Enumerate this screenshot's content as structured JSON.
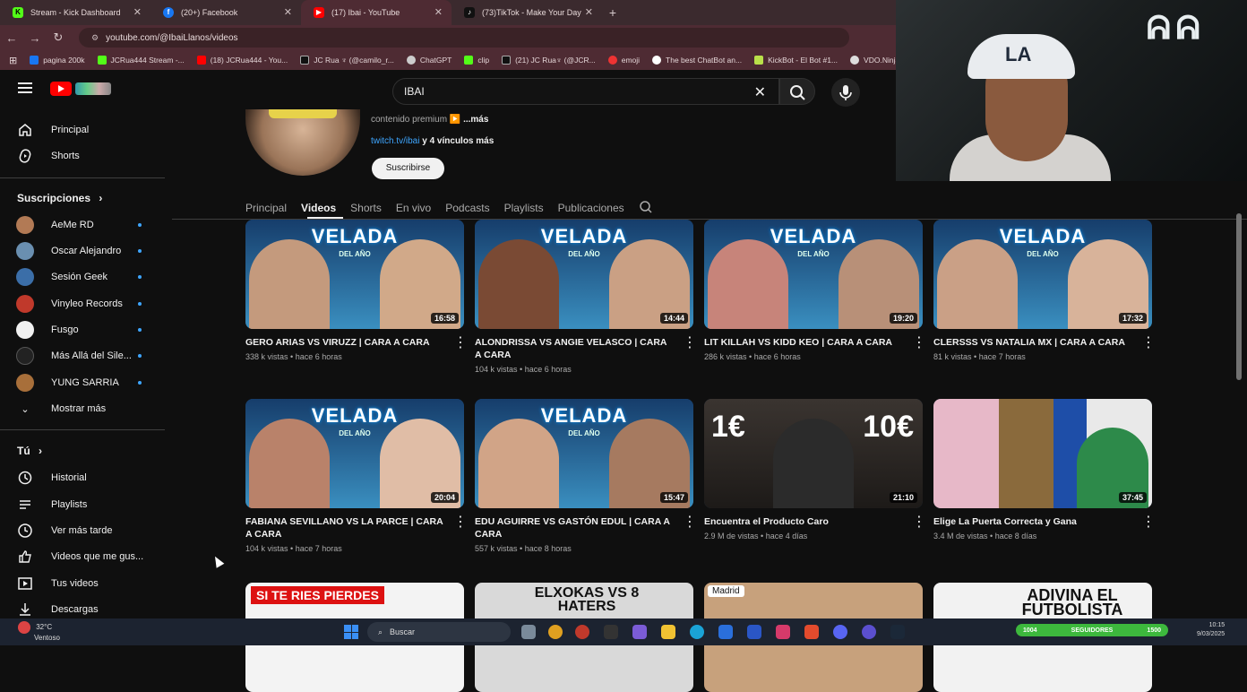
{
  "browser": {
    "tabs": [
      {
        "title": "Stream - Kick Dashboard",
        "icon": "kick-icon",
        "color": "#53fc18"
      },
      {
        "title": "(20+) Facebook",
        "icon": "facebook-icon",
        "color": "#1877f2"
      },
      {
        "title": "(17) Ibai - YouTube",
        "icon": "youtube-icon",
        "color": "#ff0000"
      },
      {
        "title": "(73)TikTok - Make Your Day",
        "icon": "tiktok-icon",
        "color": "#111111"
      }
    ],
    "url": "youtube.com/@IbaiLlanos/videos",
    "bookmarks": [
      "pagina 200k",
      "JCRua444 Stream -...",
      "(18) JCRua444 - You...",
      "JC Rua ♆ (@camilo_r...",
      "ChatGPT",
      "clip",
      "(21) JC Rua♆ (@JCR...",
      "emoji",
      "The best ChatBot an...",
      "KickBot - El Bot #1...",
      "VDO.Ninja"
    ]
  },
  "youtube": {
    "search_value": "IBAI",
    "sidebar": {
      "main": [
        {
          "label": "Principal",
          "icon": "home-icon"
        },
        {
          "label": "Shorts",
          "icon": "shorts-icon"
        }
      ],
      "subscriptions_header": "Suscripciones",
      "subscriptions": [
        {
          "label": "AeMe RD",
          "color": "#b27a55"
        },
        {
          "label": "Oscar Alejandro",
          "color": "#6a8fb0"
        },
        {
          "label": "Sesión Geek",
          "color": "#3b6ea8"
        },
        {
          "label": "Vinyleo Records",
          "color": "#c0392b"
        },
        {
          "label": "Fusgo",
          "color": "#f1f1f1"
        },
        {
          "label": "Más Allá del Sile...",
          "color": "#222222"
        },
        {
          "label": "YUNG SARRIA",
          "color": "#a86f3a"
        }
      ],
      "show_more": "Mostrar más",
      "you_header": "Tú",
      "you": [
        {
          "label": "Historial",
          "icon": "history-icon"
        },
        {
          "label": "Playlists",
          "icon": "playlists-icon"
        },
        {
          "label": "Ver más tarde",
          "icon": "watch-later-icon"
        },
        {
          "label": "Videos que me gus...",
          "icon": "like-icon"
        },
        {
          "label": "Tus videos",
          "icon": "your-videos-icon"
        },
        {
          "label": "Descargas",
          "icon": "download-icon"
        }
      ]
    },
    "channel": {
      "desc_text": "contenido premium ▶️",
      "desc_more": "...más",
      "link": "twitch.tv/ibai",
      "link_more": "y 4 vínculos más",
      "subscribe": "Suscribirse"
    },
    "tabs": [
      "Principal",
      "Videos",
      "Shorts",
      "En vivo",
      "Podcasts",
      "Playlists",
      "Publicaciones"
    ],
    "videos": [
      {
        "title": "GERO ARIAS VS VIRUZZ | CARA A CARA",
        "views": "338 k vistas",
        "age": "hace 6 horas",
        "duration": "16:58"
      },
      {
        "title": "ALONDRISSA VS ANGIE VELASCO | CARA A CARA",
        "views": "104 k vistas",
        "age": "hace 6 horas",
        "duration": "14:44"
      },
      {
        "title": "LIT KILLAH VS KIDD KEO | CARA A CARA",
        "views": "286 k vistas",
        "age": "hace 6 horas",
        "duration": "19:20"
      },
      {
        "title": "CLERSSS VS NATALIA MX | CARA A CARA",
        "views": "81 k vistas",
        "age": "hace 7 horas",
        "duration": "17:32"
      },
      {
        "title": "FABIANA SEVILLANO VS LA PARCE | CARA A CARA",
        "views": "104 k vistas",
        "age": "hace 7 horas",
        "duration": "20:04"
      },
      {
        "title": "EDU AGUIRRE VS GASTÓN EDUL | CARA A CARA",
        "views": "557 k vistas",
        "age": "hace 8 horas",
        "duration": "15:47"
      },
      {
        "title": "Encuentra el Producto Caro",
        "views": "2.9 M de vistas",
        "age": "hace 4 días",
        "duration": "21:10"
      },
      {
        "title": "Elige La Puerta Correcta y Gana",
        "views": "3.4 M de vistas",
        "age": "hace 8 días",
        "duration": "37:45"
      }
    ],
    "thumb_texts": {
      "velada_title": "VELADA",
      "velada_sub": "DEL AÑO",
      "price1": "1€",
      "price2": "10€",
      "row3": [
        "SI TE RIES PIERDES",
        "ELXOKAS VS 8 HATERS",
        "Madrid",
        "ADIVINA EL FUTBOLISTA"
      ]
    }
  },
  "taskbar": {
    "temp": "32°C",
    "weather": "Ventoso",
    "search": "Buscar",
    "obs_left": "1004",
    "obs_mid": "SEGUIDORES",
    "obs_right": "1500",
    "time": "10:15",
    "date": "9/03/2025"
  }
}
